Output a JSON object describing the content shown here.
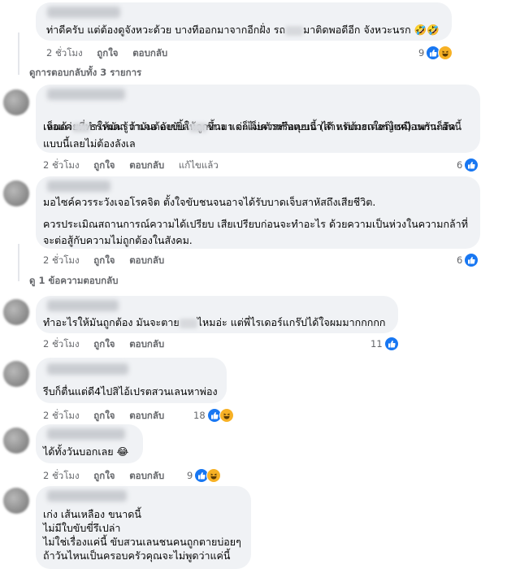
{
  "actions": {
    "like": "ถูกใจ",
    "reply": "ตอบกลับ",
    "edited": "แก้ไขแล้ว"
  },
  "comments": [
    {
      "line1": "ท่าดีครับ แต่ต้องดูจังหวะด้วย บางทีออกมาจากอีกฝั่ง รถ",
      "line1b": "มาติดพอดีอีก จังหวะนรก",
      "time": "2 ชั่วโมง",
      "count": "9"
    },
    {
      "line1": "เห็นด้วยที่ทำให้มันรู้ว่ามันต้องขับให้ถูกทาง แต่ก็ไม่ควรทำแบบนี้ (สำหรับมอเตอร์ไซค์) เพราะอันนี้",
      "line2a": "เจอแค่",
      "line2b": "ธรรมดา ถ้าเจอ ดับเบิ้ล",
      "line2c": "ขึ้นมา จะเจ็บตัวหรือตุยเอาได้ แต่ถ้ารถใหญ่เหมือนกันก็จัด",
      "line3": "แบบนี้เลยไม่ต้องลังเล",
      "time": "2 ชั่วโมง",
      "count": "6"
    },
    {
      "line1": "มอไซค์ควรระวังเจอโรคจิต ตั้งใจขับชนจนอาจได้รับบาดเจ็บสาหัสถึงเสียชีวิต.",
      "line2": "ควรประเมิณสถานการณ์ความได้เปรียบ เสียเปรียบก่อนจะทำอะไร ด้วยความเป็นห่วงในความกล้าที่",
      "line3": "จะต่อสู้กับความไม่ถูกต้องในสังคม.",
      "time": "2 ชั่วโมง",
      "count": "6"
    },
    {
      "line1a": "ทำอะไรให้มันถูกต้อง มันจะตาย",
      "line1b": "ไหมอ่ะ แต่พี่ไรเดอร์แกร๊ปได้ใจผมมากกกกก",
      "time": "2 ชั่วโมง",
      "count": "11"
    },
    {
      "line1": "รีบก็ตื่นแต่ดี4ไปสิไอ้เปรตสวนเลนหาพ่อง",
      "time": "2 ชั่วโมง",
      "count": "18"
    },
    {
      "line1": "ได้ทั้งวันบอกเลย",
      "time": "2 ชั่วโมง",
      "count": "9"
    },
    {
      "line1": "เก่ง เส้นเหลือง ขนาดนี้",
      "line2": "ไม่มีใบขับขี่รึเปล่า",
      "line3": "ไม่ใช่เรื่องแค่นี้ ขับสวนเลนชนคนถูกตายบ่อยๆ",
      "line4": "ถ้าวันไหนเป็นครอบครัวคุณจะไม่พูดว่าแค่นี้"
    }
  ],
  "view_all_replies": "ดูการตอบกลับทั้ง 3 รายการ",
  "view_one_reply": "ดู 1 ข้อความตอบกลับ"
}
